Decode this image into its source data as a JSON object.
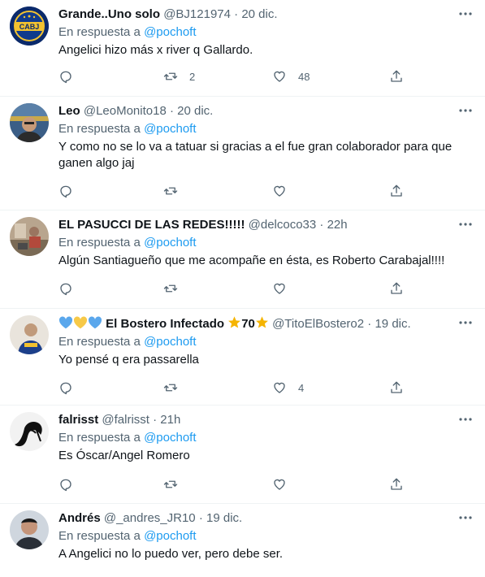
{
  "reply_prefix": "En respuesta a",
  "tweets": [
    {
      "name": "Grande..Uno solo",
      "handle": "@BJ121974",
      "sep": "·",
      "time": "20 dic.",
      "mention": "@pochoft",
      "text": "Angelici hizo más x river q Gallardo.",
      "retweets": "2",
      "likes": "48",
      "avatar_label": "CABJ"
    },
    {
      "name": "Leo",
      "handle": "@LeoMonito18",
      "sep": "·",
      "time": "20 dic.",
      "mention": "@pochoft",
      "text": "Y como no se lo va a tatuar si gracias a el fue gran colaborador para que ganen algo jaj",
      "retweets": "",
      "likes": ""
    },
    {
      "name": "EL PASUCCI DE LAS REDES!!!!!",
      "handle": "@delcoco33",
      "sep": "·",
      "time": "22h",
      "mention": "@pochoft",
      "text": "Algún Santiagueño que me acompañe en ésta, es Roberto Carabajal!!!!",
      "retweets": "",
      "likes": ""
    },
    {
      "name": "El Bostero Infectado",
      "name_number": "70",
      "handle": "@TitoElBostero2",
      "sep": "·",
      "time": "19 dic.",
      "mention": "@pochoft",
      "text": "Yo pensé q era passarella",
      "retweets": "",
      "likes": "4"
    },
    {
      "name": "falrisst",
      "handle": "@falrisst",
      "sep": "·",
      "time": "21h",
      "mention": "@pochoft",
      "text": "Es Óscar/Angel Romero",
      "retweets": "",
      "likes": ""
    },
    {
      "name": "Andrés",
      "handle": "@_andres_JR10",
      "sep": "·",
      "time": "19 dic.",
      "mention": "@pochoft",
      "text": "A Angelici no lo puedo ver, pero debe ser.",
      "retweets": "",
      "likes": ""
    }
  ],
  "colors": {
    "text": "#0f1419",
    "secondary": "#536471",
    "accent": "#1d9bf0",
    "border": "#eff3f4"
  },
  "icons": [
    "more-icon",
    "reply-icon",
    "retweet-icon",
    "like-icon",
    "share-icon",
    "blue-heart-icon",
    "yellow-heart-icon",
    "star-icon"
  ]
}
